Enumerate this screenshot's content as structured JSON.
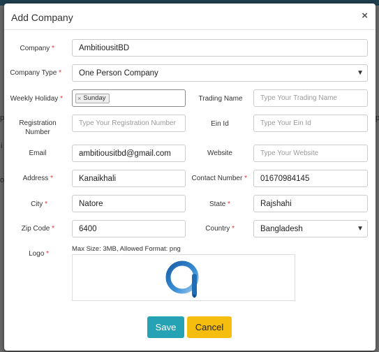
{
  "modal": {
    "title": "Add Company",
    "close_icon": "close-icon"
  },
  "labels": {
    "company": "Company",
    "company_type": "Company Type",
    "weekly_holiday": "Weekly Holiday",
    "trading_name": "Trading Name",
    "registration_number_1": "Registration",
    "registration_number_2": "Number",
    "ein_id": "Ein Id",
    "email": "Email",
    "website": "Website",
    "address": "Address",
    "contact_number": "Contact Number",
    "city": "City",
    "state": "State",
    "zip_code": "Zip Code",
    "country": "Country",
    "logo": "Logo",
    "required_mark": "*"
  },
  "fields": {
    "company": "AmbitiousitBD",
    "company_type": "One Person Company",
    "weekly_holiday_tag": "Sunday",
    "tag_remove": "×",
    "trading_name_placeholder": "Type Your Trading Name",
    "registration_number_placeholder": "Type Your Registration Number",
    "ein_id_placeholder": "Type Your Ein Id",
    "email": "ambitiousitbd@gmail.com",
    "website_placeholder": "Type Your Website",
    "address": "Kanaikhali",
    "contact_number": "01670984145",
    "city": "Natore",
    "state": "Rajshahi",
    "zip_code": "6400",
    "country": "Bangladesh"
  },
  "logo": {
    "hint": "Max Size: 3MB, Allowed Format: png",
    "icon": "company-logo-icon"
  },
  "buttons": {
    "save": "Save",
    "cancel": "Cancel"
  },
  "background": {
    "frag_1": "p",
    "frag_2": "i",
    "frag_3": "o",
    "frag_4": "p"
  },
  "colors": {
    "save": "#26a2b5",
    "cancel": "#f5bd0e",
    "required": "#e3342f"
  }
}
